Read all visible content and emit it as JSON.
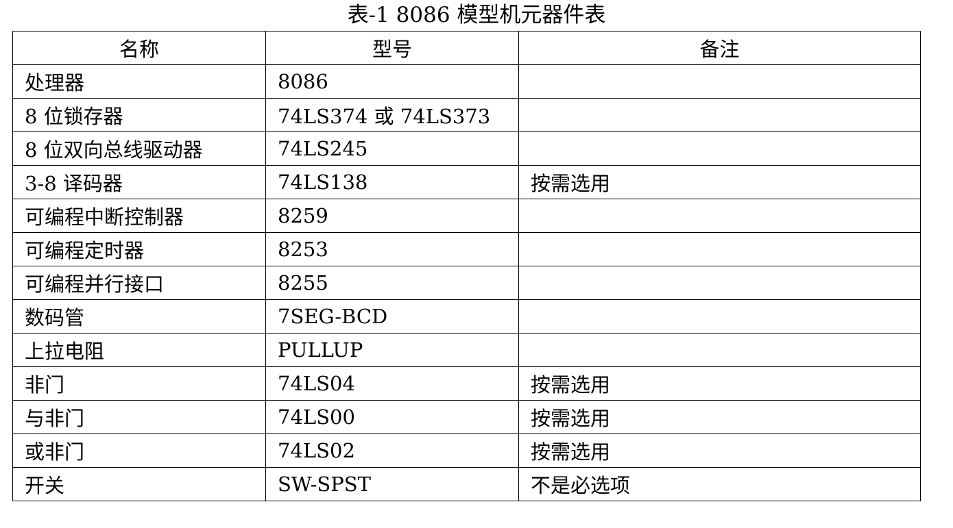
{
  "document": {
    "title": "表-1 8086 模型机元器件表"
  },
  "table": {
    "headers": [
      "名称",
      "型号",
      "备注"
    ],
    "rows": [
      [
        "处理器",
        "8086",
        ""
      ],
      [
        "8 位锁存器",
        "74LS374 或 74LS373",
        ""
      ],
      [
        "8 位双向总线驱动器",
        "74LS245",
        ""
      ],
      [
        "3-8 译码器",
        "74LS138",
        "按需选用"
      ],
      [
        "可编程中断控制器",
        "8259",
        ""
      ],
      [
        "可编程定时器",
        "8253",
        ""
      ],
      [
        "可编程并行接口",
        "8255",
        ""
      ],
      [
        "数码管",
        "7SEG-BCD",
        ""
      ],
      [
        "上拉电阻",
        "PULLUP",
        ""
      ],
      [
        "非门",
        "74LS04",
        "按需选用"
      ],
      [
        "与非门",
        "74LS00",
        "按需选用"
      ],
      [
        "或非门",
        "74LS02",
        "按需选用"
      ],
      [
        "开关",
        "SW-SPST",
        "不是必选项"
      ]
    ]
  }
}
